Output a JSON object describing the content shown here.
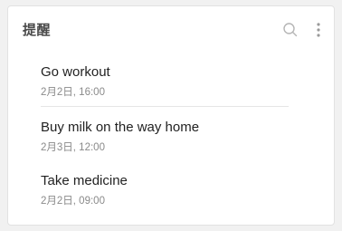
{
  "header": {
    "title": "提醒",
    "search_icon": "search-icon",
    "more_icon": "more-vertical-icon"
  },
  "reminders": [
    {
      "title": "Go workout",
      "time": "2月2日, 16:00"
    },
    {
      "title": "Buy milk on the way home",
      "time": "2月3日, 12:00"
    },
    {
      "title": "Take medicine",
      "time": "2月2日, 09:00"
    }
  ]
}
